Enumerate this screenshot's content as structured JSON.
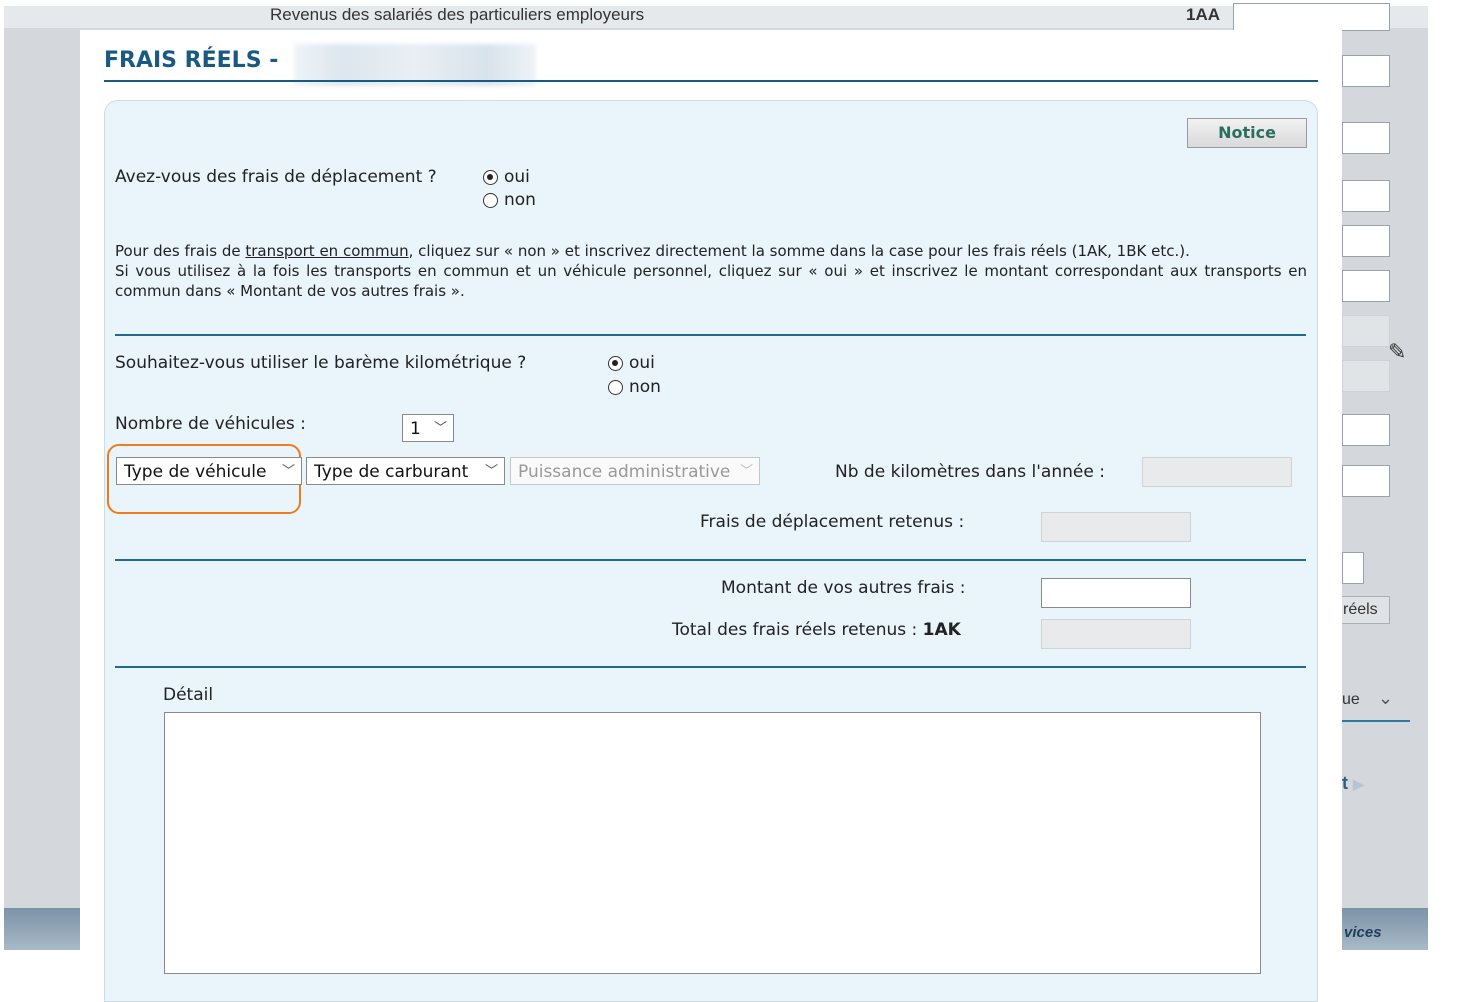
{
  "background": {
    "header_label": "Revenus des salariés des particuliers employeurs",
    "header_code": "1AA",
    "reels_button_fragment": "réels",
    "ue_fragment": "ue",
    "t_link_fragment": "t",
    "footer_fragment": "vices"
  },
  "modal": {
    "title": "FRAIS RÉELS -",
    "notice_label": "Notice",
    "q1": {
      "label": "Avez-vous des frais de déplacement ?",
      "options": [
        "oui",
        "non"
      ],
      "selected": "oui"
    },
    "info": {
      "line1_a": "Pour des frais de ",
      "line1_link": "transport en commun",
      "line1_b": ", cliquez sur « non » et inscrivez directement la somme dans la case pour les frais réels (1AK, 1BK etc.).",
      "line2": "Si vous utilisez à la fois les transports en commun et un véhicule personnel, cliquez sur « oui » et inscrivez le montant correspondant aux transports en commun dans « Montant de vos autres frais »."
    },
    "q2": {
      "label": "Souhaitez-vous utiliser le barème kilométrique ?",
      "options": [
        "oui",
        "non"
      ],
      "selected": "oui"
    },
    "vehicles_label": "Nombre de véhicules :",
    "vehicles_value": "1",
    "vehicle_type_label": "Type de véhicule",
    "fuel_type_label": "Type de carburant",
    "power_label": "Puissance administrative",
    "km_label": "Nb de kilomètres dans l'année :",
    "travel_costs_label": "Frais de déplacement retenus :",
    "other_costs_label": "Montant de vos autres frais :",
    "total_label": "Total des frais réels retenus :",
    "total_code": "1AK",
    "detail_label": "Détail"
  },
  "colors": {
    "title": "#1a5a82",
    "panel_bg": "#eaf4fb",
    "rule": "#1e6b8e",
    "highlight": "#f07b1e"
  }
}
